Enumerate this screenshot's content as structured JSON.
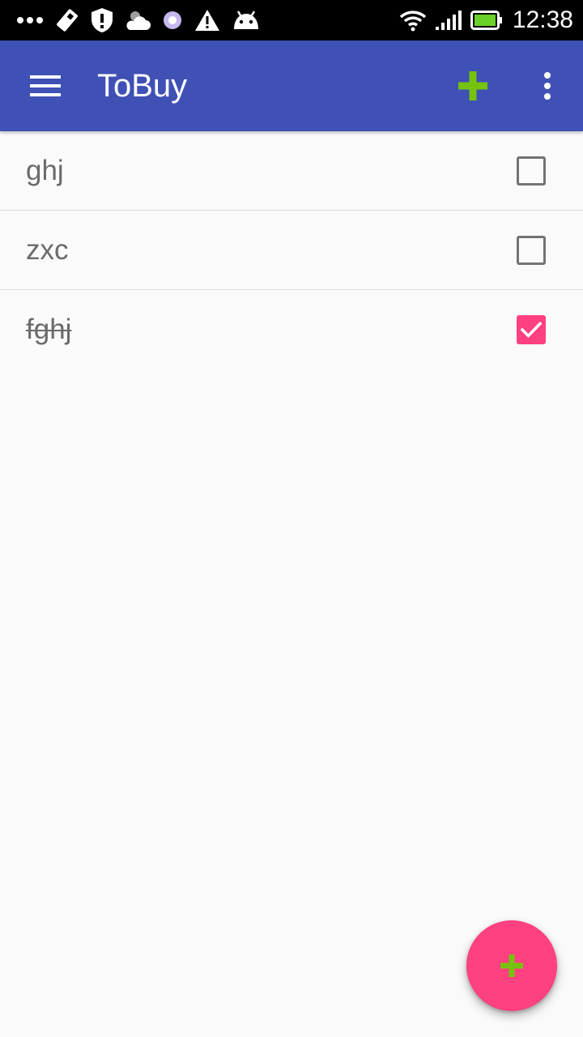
{
  "status_bar": {
    "time": "12:38",
    "left_icons": [
      "more-dots-icon",
      "app-notification-icon",
      "shield-icon",
      "weather-icon",
      "circle-app-icon",
      "warning-icon",
      "android-icon"
    ],
    "right_icons": [
      "wifi-icon",
      "signal-icon",
      "battery-icon"
    ]
  },
  "toolbar": {
    "title": "ToBuy",
    "menu_icon": "hamburger-icon",
    "add_icon": "plus-icon",
    "overflow_icon": "more-vertical-icon",
    "background_color": "#3f51b5",
    "add_icon_color": "#76c30d"
  },
  "items": [
    {
      "label": "ghj",
      "checked": false
    },
    {
      "label": "zxc",
      "checked": false
    },
    {
      "label": "fghj",
      "checked": true
    }
  ],
  "fab": {
    "icon": "plus-icon",
    "background_color": "#ff4081",
    "icon_color": "#76c30d"
  }
}
